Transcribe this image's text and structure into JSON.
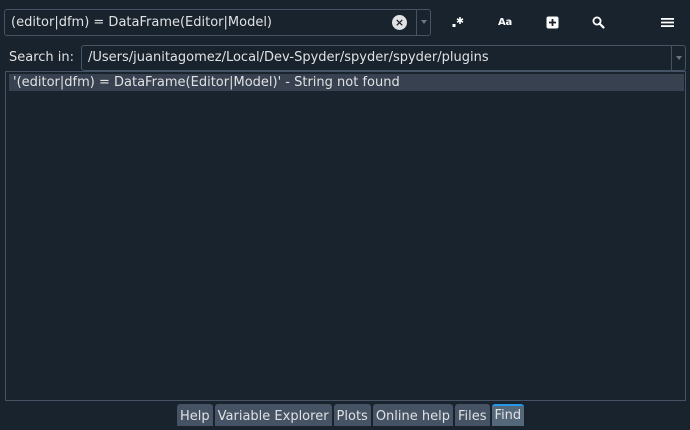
{
  "find": {
    "search_text": "(editor|dfm) = DataFrame(Editor|Model)",
    "clear_glyph": "×",
    "toolbar": {
      "regex_icon": "regex-icon",
      "case_label": "Aa",
      "case_icon": "case-sensitive-icon",
      "add_icon": "plus-square-icon",
      "search_icon": "magnifier-icon",
      "options_icon": "hamburger-menu-icon"
    },
    "search_in_label": "Search in:",
    "search_in_path": "/Users/juanitagomez/Local/Dev-Spyder/spyder/spyder/plugins"
  },
  "results": [
    {
      "text": "'(editor|dfm) = DataFrame(Editor|Model)' - String not found"
    }
  ],
  "tabs": [
    {
      "label": "Help",
      "active": false
    },
    {
      "label": "Variable Explorer",
      "active": false
    },
    {
      "label": "Plots",
      "active": false
    },
    {
      "label": "Online help",
      "active": false
    },
    {
      "label": "Files",
      "active": false
    },
    {
      "label": "Find",
      "active": true
    }
  ],
  "colors": {
    "background": "#19232d",
    "border": "#455364",
    "selection": "#37414f",
    "tab_bg": "#455364",
    "tab_active_accent": "#259ae9"
  }
}
